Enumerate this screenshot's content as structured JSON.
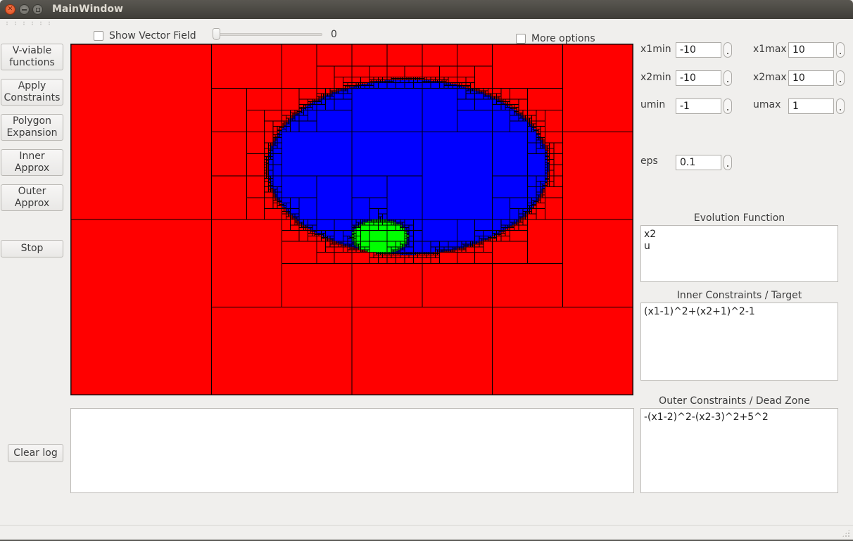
{
  "window": {
    "title": "MainWindow",
    "controls": [
      "close",
      "minimize",
      "maximize"
    ]
  },
  "toolbar": {
    "show_vector_field": {
      "label": "Show Vector Field",
      "checked": false
    },
    "slider": {
      "value": 0,
      "min": 0,
      "display": "0"
    },
    "more_options": {
      "label": "More options",
      "checked": false
    }
  },
  "left_buttons": [
    {
      "id": "v-viable",
      "label": "V-viable\nfunctions"
    },
    {
      "id": "apply-constraints",
      "label": "Apply\nConstraints"
    },
    {
      "id": "polygon-expansion",
      "label": "Polygon\nExpansion"
    },
    {
      "id": "inner-approx",
      "label": "Inner\nApprox"
    },
    {
      "id": "outer-approx",
      "label": "Outer\nApprox"
    },
    {
      "id": "stop",
      "label": "Stop"
    }
  ],
  "clear_log_label": "Clear log",
  "log_text": "",
  "parameters": {
    "x1min": {
      "label": "x1min",
      "value": "-10"
    },
    "x1max": {
      "label": "x1max",
      "value": "10"
    },
    "x2min": {
      "label": "x2min",
      "value": "-10"
    },
    "x2max": {
      "label": "x2max",
      "value": "10"
    },
    "umin": {
      "label": "umin",
      "value": "-1"
    },
    "umax": {
      "label": "umax",
      "value": "1"
    },
    "eps": {
      "label": "eps",
      "value": "0.1"
    }
  },
  "evolution_function": {
    "title": "Evolution Function",
    "text": "x2\nu"
  },
  "inner_constraints": {
    "title": "Inner Constraints / Target",
    "text": "(x1-1)^2+(x2+1)^2-1"
  },
  "outer_constraints": {
    "title": "Outer Constraints / Dead Zone",
    "text": "-(x1-2)^2-(x2-3)^2+5^2"
  },
  "paving": {
    "domain": {
      "x1": [
        -10,
        10
      ],
      "x2": [
        -10,
        10
      ]
    },
    "colors": {
      "outside": "#ff0000",
      "viable": "#0000ff",
      "target": "#00ff00",
      "border": "#000000"
    },
    "outer_circle": {
      "center": [
        2,
        3
      ],
      "radius": 5
    },
    "inner_circle": {
      "center": [
        1,
        -1
      ],
      "radius": 1
    },
    "eps": 0.1
  }
}
